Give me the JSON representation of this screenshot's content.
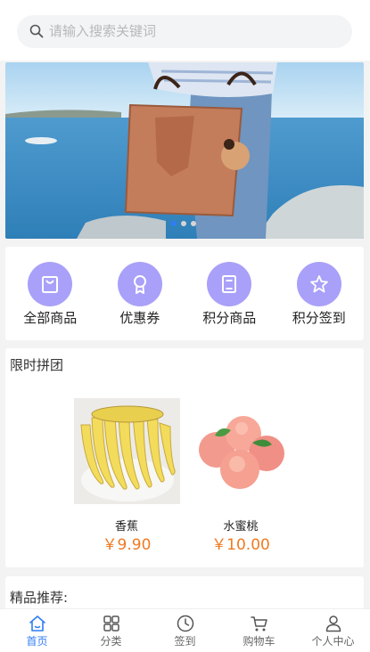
{
  "search": {
    "placeholder": "请输入搜索关键词"
  },
  "banner": {
    "slides": 3,
    "active_slide": 1
  },
  "menu": {
    "items": [
      {
        "label": "全部商品",
        "icon": "bag-icon"
      },
      {
        "label": "优惠券",
        "icon": "ribbon-badge-icon"
      },
      {
        "label": "积分商品",
        "icon": "book-icon"
      },
      {
        "label": "积分签到",
        "icon": "star-icon"
      }
    ]
  },
  "group_buy": {
    "title": "限时拼团",
    "products": [
      {
        "name": "香蕉",
        "price": "￥9.90",
        "image": "banana-image"
      },
      {
        "name": "水蜜桃",
        "price": "￥10.00",
        "image": "peach-image"
      }
    ]
  },
  "recommend": {
    "title": "精品推荐:"
  },
  "tabbar": {
    "items": [
      {
        "label": "首页",
        "icon": "home-icon",
        "active": true
      },
      {
        "label": "分类",
        "icon": "grid-icon",
        "active": false
      },
      {
        "label": "签到",
        "icon": "clock-icon",
        "active": false
      },
      {
        "label": "购物车",
        "icon": "cart-icon",
        "active": false
      },
      {
        "label": "个人中心",
        "icon": "user-icon",
        "active": false
      }
    ]
  },
  "colors": {
    "accent": "#2f7df6",
    "menu_icon_bg": "#a9a0f9",
    "price": "#f07a21"
  }
}
